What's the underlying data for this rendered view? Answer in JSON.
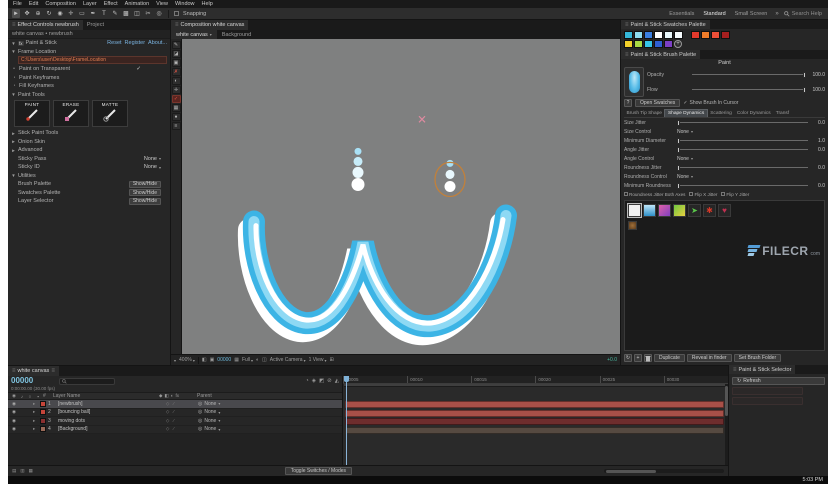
{
  "window": {
    "clock": "5:03 PM"
  },
  "ui": {
    "check": "✓",
    "open": "▼",
    "closed": "►",
    "tri": "▸",
    "dd": "▾",
    "burger": "≡",
    "eye": "◉",
    "whip": "◎",
    "add": "+",
    "reload": "↻",
    "bullet": "•"
  },
  "colors": {
    "paint_blue": "#3cb4e5",
    "paint_mid": "#8ed9f4",
    "white": "#ffffff",
    "dot_a": "#a9e1f6",
    "dot_b": "#c6ecf9",
    "dot_c": "#e9f8fd",
    "dot_d": "#ffffff",
    "cursor_orange": "#c2803a",
    "marker_pink": "#df8aa0"
  },
  "menubar": {
    "items": [
      "File",
      "Edit",
      "Composition",
      "Layer",
      "Effect",
      "Animation",
      "View",
      "Window",
      "Help"
    ]
  },
  "toolbar": {
    "tools": [
      {
        "name": "selection-tool",
        "glyph": "►"
      },
      {
        "name": "hand-tool",
        "glyph": "✥"
      },
      {
        "name": "zoom-tool",
        "glyph": "⊕"
      },
      {
        "name": "orbit-camera-tool",
        "glyph": "↻"
      },
      {
        "name": "camera-tool",
        "glyph": "◉"
      },
      {
        "name": "pan-behind-tool",
        "glyph": "✛"
      },
      {
        "name": "shape-tool",
        "glyph": "▭"
      },
      {
        "name": "pen-tool",
        "glyph": "✒"
      },
      {
        "name": "type-tool",
        "glyph": "T"
      },
      {
        "name": "brush-tool",
        "glyph": "✎"
      },
      {
        "name": "clone-stamp-tool",
        "glyph": "▩"
      },
      {
        "name": "eraser-tool",
        "glyph": "◫"
      },
      {
        "name": "roto-brush-tool",
        "glyph": "✂"
      },
      {
        "name": "puppet-pin-tool",
        "glyph": "◎"
      }
    ],
    "snapping": "Snapping",
    "workspaces": [
      "Essentials",
      "Standard",
      "Small Screen"
    ],
    "overflow": "»",
    "search_label": "Search Help"
  },
  "effect_controls": {
    "tab_active": "Effect Controls newbrush",
    "tab_project": "Project",
    "breadcrumb": "white canvas • newbrush",
    "effect": {
      "badge": "fx",
      "name": "Paint & Stick",
      "reset": "Reset",
      "register": "Register",
      "about": "About..."
    },
    "frame_location_label": "Frame Location",
    "frame_location_value": "C:\\Users\\user\\Desktop\\FrameLocation",
    "paint_on_transparent": "Paint on Transparent",
    "paint_keyframes": "Paint Keyframes",
    "fill_keyframes": "Fill Keyframes",
    "paint_tools_label": "Paint Tools",
    "tool_buttons": [
      "PAINT",
      "ERASE",
      "MATTE"
    ],
    "collapsed_groups": [
      "Stick Paint Tools",
      "Onion Skin",
      "Advanced"
    ],
    "sticky_pass_label": "Sticky Pass",
    "sticky_pass_value": "None",
    "sticky_id_label": "Sticky ID",
    "sticky_id_value": "None",
    "utilities_label": "Utilities",
    "utility_rows": [
      {
        "label": "Brush Palette",
        "action": "Show/Hide"
      },
      {
        "label": "Swatches Palette",
        "action": "Show/Hide"
      },
      {
        "label": "Layer Selector",
        "action": "Show/Hide"
      }
    ]
  },
  "composition": {
    "tab": "Composition white canvas",
    "viewer_tab_active": "white canvas",
    "viewer_tab_inactive": "Background",
    "icons": [
      "◧",
      "▣",
      "▦",
      "◐",
      "◫",
      "⊞"
    ],
    "status": {
      "zoom": "400%",
      "timecode": "00000",
      "resolution": "Full",
      "camera": "Active Camera",
      "view": "1 View",
      "exposure": "+0.0"
    }
  },
  "paint_strip": [
    {
      "name": "paint-brush-tool",
      "glyph": "✎"
    },
    {
      "name": "erase-tool",
      "glyph": "◪"
    },
    {
      "name": "fill-tool",
      "glyph": "▣"
    },
    {
      "name": "clear-tool",
      "glyph": "✗"
    },
    {
      "name": "matte-tool",
      "glyph": "◐"
    },
    {
      "name": "transform-tool",
      "glyph": "✛"
    },
    {
      "name": "onion-skin-toggle",
      "glyph": "✓"
    },
    {
      "name": "swatches-toggle",
      "glyph": "▦"
    },
    {
      "name": "brush-size-tool",
      "glyph": "●"
    },
    {
      "name": "strip-handle",
      "glyph": "≡"
    }
  ],
  "swatches_panel": {
    "title": "Paint & Stick Swatches Palette",
    "rows": [
      {
        "cool": [
          "#35b8da",
          "#8edcf0",
          "#3a7fe0",
          "#ffffff",
          "#e9f7fb",
          "#f7fcfe"
        ],
        "warm": [
          "#e2392c",
          "#f07c2a",
          "#ee4f38",
          "#a61f1f"
        ]
      },
      {
        "cool": [
          "#f3d02a",
          "#a8d843",
          "#35c4e8",
          "#2f5fd2",
          "#7b3fc4"
        ],
        "warm": []
      }
    ]
  },
  "brush_panel": {
    "title": "Paint & Stick Brush Palette",
    "paint_label": "Paint",
    "opacity_label": "Opacity",
    "opacity_value": "100.0",
    "flow_label": "Flow",
    "flow_value": "100.0",
    "help": "?",
    "open_swatches": "Open Swatches",
    "show_brush_in_cursor": "Show Brush In Cursor",
    "tabs": [
      "Brush Tip Shape",
      "Shape Dynamics",
      "Scattering",
      "Color Dynamics",
      "Transf"
    ],
    "rows": [
      {
        "label": "Size Jitter",
        "value": "0.0"
      },
      {
        "label": "Size Control",
        "value": "None"
      },
      {
        "label": "Minimum Diameter",
        "value": "1.0"
      },
      {
        "label": "Angle Jitter",
        "value": "0.0"
      },
      {
        "label": "Angle Control",
        "value": "None"
      },
      {
        "label": "Roundness Jitter",
        "value": "0.0"
      },
      {
        "label": "Roundness Control",
        "value": "None"
      },
      {
        "label": "Minimum Roundness",
        "value": "0.0"
      }
    ],
    "check_row": [
      "Roundness Jitter Both Axes",
      "Flip X Jitter",
      "Flip Y Jitter"
    ],
    "presets": [
      "solid-round",
      "soft-round-blue",
      "character-pink",
      "character-green",
      "arrow-green",
      "splat-red",
      "heart-red",
      "blob-brown"
    ],
    "preset_glyphs": {
      "arrow": "➤",
      "splat": "✱",
      "heart": "♥"
    },
    "footer": {
      "duplicate": "Duplicate",
      "reveal": "Reveal in finder",
      "set_folder": "Set Brush Folder"
    }
  },
  "watermark": {
    "name": "FILECR",
    "tld": "com"
  },
  "selector_panel": {
    "title": "Paint & Stick Selector",
    "refresh": "Refresh"
  },
  "timeline": {
    "tab": "white canvas",
    "timecode": "00000",
    "timecode_sub": "0:00:00.00 (30.00 fps)",
    "head_icons": [
      {
        "name": "comp-mini-flowchart-icon",
        "glyph": "◔"
      },
      {
        "name": "draft-3d-icon",
        "glyph": "◈"
      },
      {
        "name": "hide-shy-icon",
        "glyph": "◩"
      },
      {
        "name": "frame-blend-icon",
        "glyph": "⊘"
      },
      {
        "name": "motion-blur-icon",
        "glyph": "◭"
      }
    ],
    "col_icons": [
      {
        "name": "video-column-icon",
        "glyph": "◉"
      },
      {
        "name": "audio-column-icon",
        "glyph": "♪"
      },
      {
        "name": "solo-column-icon",
        "glyph": "○"
      },
      {
        "name": "lock-column-icon",
        "glyph": "▪"
      }
    ],
    "col_number": "#",
    "col_layer_name": "Layer Name",
    "switch_icons": [
      "◆",
      "◧",
      "◐",
      "fx"
    ],
    "col_parent": "Parent",
    "row_switch_icons": [
      "◇",
      "⁄"
    ],
    "layers": [
      {
        "num": "1",
        "name": "[newbrush]",
        "parent": "None",
        "label_color": "#c5453a",
        "bar_color": "#a85048"
      },
      {
        "num": "2",
        "name": "[bouncing ball]",
        "parent": "None",
        "label_color": "#c5453a",
        "bar_color": "#a85048"
      },
      {
        "num": "3",
        "name": "moving dots",
        "parent": "None",
        "label_color": "#8a2f2f",
        "bar_color": "#6e2d2d"
      },
      {
        "num": "4",
        "name": "[Background]",
        "parent": "None",
        "label_color": "#9a6a58",
        "bar_color": "#564a41"
      }
    ],
    "ruler": [
      "00005",
      "00010",
      "00015",
      "00020",
      "00025",
      "00030"
    ],
    "footer_icons": [
      "▤",
      "▥",
      "▦"
    ],
    "toggle_button": "Toggle Switches / Modes"
  }
}
